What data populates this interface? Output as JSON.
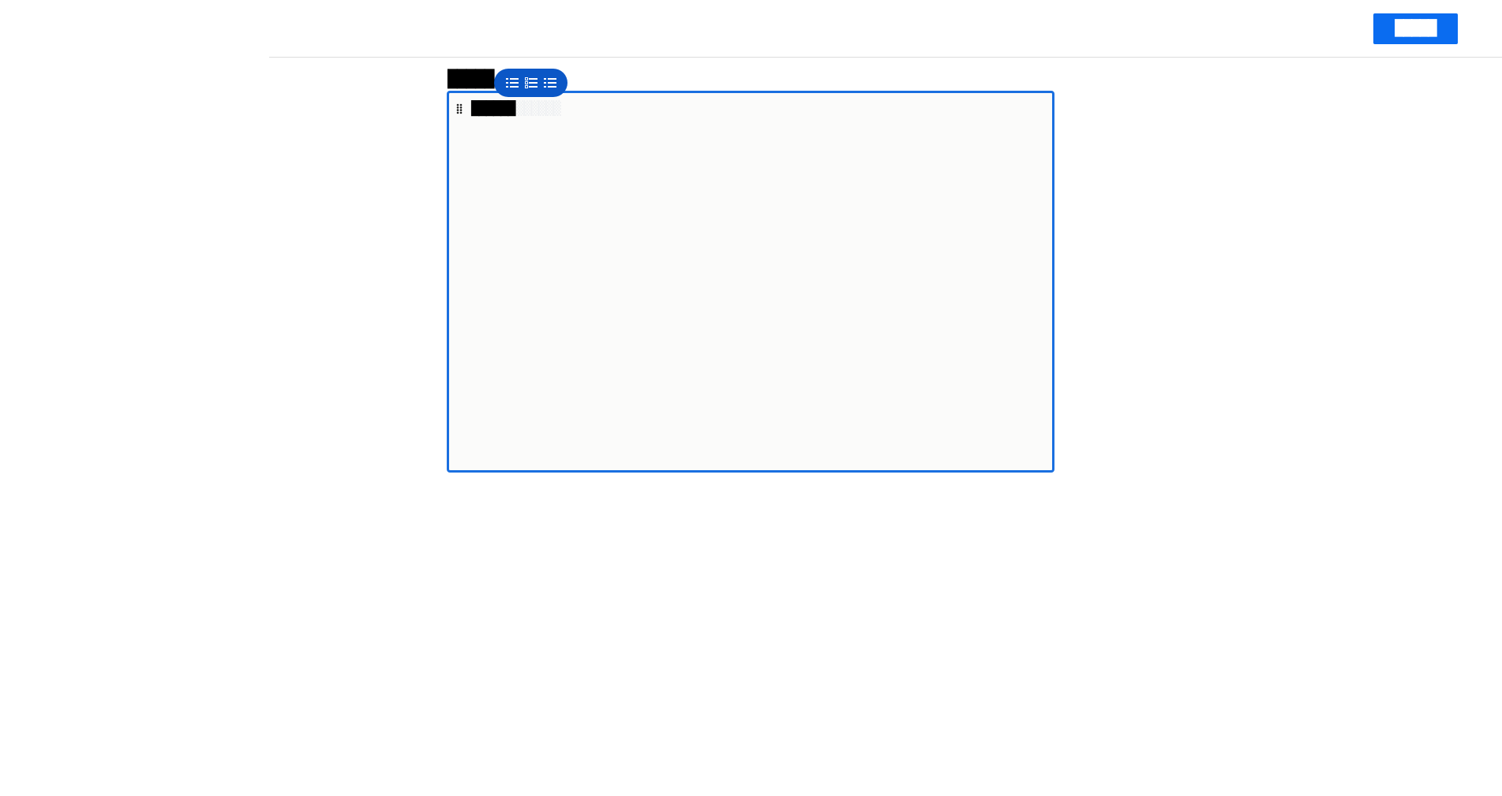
{
  "header": {
    "primary_button_label": "█████"
  },
  "section": {
    "heading": "█████"
  },
  "toolbar": {
    "buttons": [
      {
        "name": "bulleted-list",
        "icon": "list-icon"
      },
      {
        "name": "checklist",
        "icon": "checklist-icon"
      },
      {
        "name": "numbered-list",
        "icon": "list-icon"
      }
    ]
  },
  "editor": {
    "first_block_text": "██████",
    "first_block_placeholder": "▒▒▒▒▒▒"
  },
  "colors": {
    "accent": "#0a6cf0",
    "editor_border": "#1a6fe0",
    "toolbar_bg": "#0b57c6",
    "editor_bg": "#fbfbfa"
  }
}
